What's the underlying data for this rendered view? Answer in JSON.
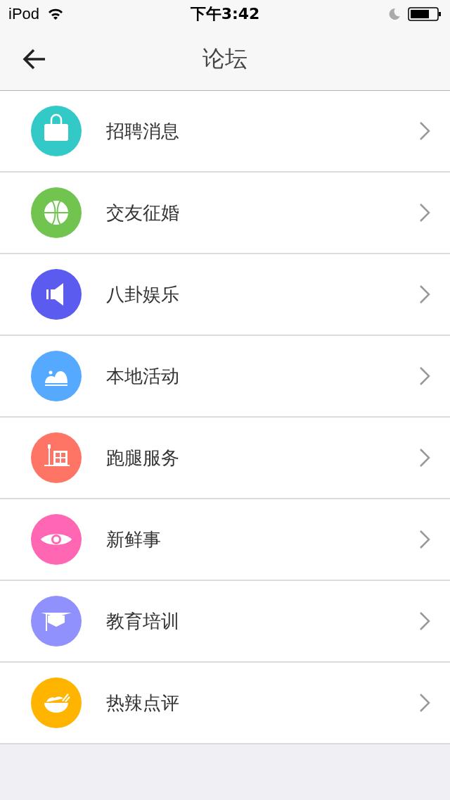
{
  "status_bar": {
    "carrier": "iPod",
    "time": "下午3:42"
  },
  "nav": {
    "title": "论坛"
  },
  "items": [
    {
      "label": "招聘消息",
      "kind": "bag",
      "color": "#33c9c6"
    },
    {
      "label": "交友征婚",
      "kind": "ball",
      "color": "#71c450"
    },
    {
      "label": "八卦娱乐",
      "kind": "speaker",
      "color": "#5b5cef"
    },
    {
      "label": "本地活动",
      "kind": "hills",
      "color": "#55aaff"
    },
    {
      "label": "跑腿服务",
      "kind": "building",
      "color": "#ff7565"
    },
    {
      "label": "新鲜事",
      "kind": "eye",
      "color": "#ff66b3"
    },
    {
      "label": "教育培训",
      "kind": "cap",
      "color": "#9191fd"
    },
    {
      "label": "热辣点评",
      "kind": "bowl",
      "color": "#ffb400"
    }
  ]
}
